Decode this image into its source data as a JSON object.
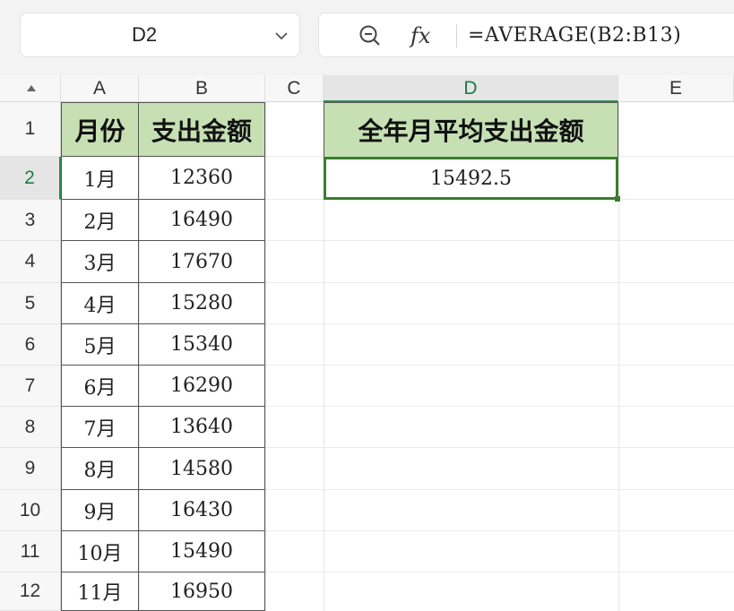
{
  "name_box": {
    "value": "D2"
  },
  "formula_bar": {
    "fx_label": "fx",
    "formula": "=AVERAGE(B2:B13)"
  },
  "columns": [
    "A",
    "B",
    "C",
    "D",
    "E"
  ],
  "active_column": "D",
  "rows": [
    "1",
    "2",
    "3",
    "4",
    "5",
    "6",
    "7",
    "8",
    "9",
    "10",
    "11",
    "12"
  ],
  "active_row": "2",
  "table": {
    "header": {
      "month": "月份",
      "amount": "支出金额"
    },
    "rows": [
      {
        "month": "1月",
        "amount": "12360"
      },
      {
        "month": "2月",
        "amount": "16490"
      },
      {
        "month": "3月",
        "amount": "17670"
      },
      {
        "month": "4月",
        "amount": "15280"
      },
      {
        "month": "5月",
        "amount": "15340"
      },
      {
        "month": "6月",
        "amount": "16290"
      },
      {
        "month": "7月",
        "amount": "13640"
      },
      {
        "month": "8月",
        "amount": "14580"
      },
      {
        "month": "9月",
        "amount": "16430"
      },
      {
        "month": "10月",
        "amount": "15490"
      },
      {
        "month": "11月",
        "amount": "16950"
      }
    ]
  },
  "result": {
    "header": "全年月平均支出金额",
    "value": "15492.5"
  },
  "colors": {
    "header_fill": "#c6e0b4",
    "selection": "#3a7d2f",
    "active_header_text": "#1f7a45"
  }
}
